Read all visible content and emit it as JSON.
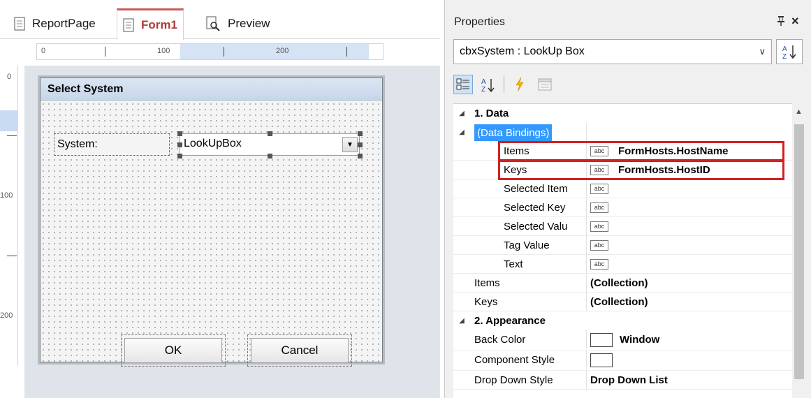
{
  "designer": {
    "tabs": [
      {
        "label": "ReportPage",
        "icon": "page-icon"
      },
      {
        "label": "Form1",
        "icon": "page-icon"
      },
      {
        "label": "Preview",
        "icon": "preview-icon"
      }
    ],
    "ruler_top_labels": [
      "0",
      "100",
      "200"
    ],
    "ruler_left_labels": [
      "0",
      "100",
      "200"
    ],
    "form": {
      "title": "Select System",
      "system_label": "System:",
      "lookup_text": "LookUpBox",
      "ok_label": "OK",
      "cancel_label": "Cancel"
    }
  },
  "properties": {
    "panel_title": "Properties",
    "pin_icon": "pin-icon",
    "close_icon": "close-icon",
    "object_selector": "cbxSystem : LookUp Box",
    "rows": [
      {
        "name": "1. Data",
        "value": "",
        "kind": "category"
      },
      {
        "name": "(Data Bindings)",
        "value": "",
        "kind": "subcategory"
      },
      {
        "name": "Items",
        "value": "FormHosts.HostName",
        "kind": "binding"
      },
      {
        "name": "Keys",
        "value": "FormHosts.HostID",
        "kind": "binding"
      },
      {
        "name": "Selected Item",
        "value": "",
        "kind": "binding"
      },
      {
        "name": "Selected Key",
        "value": "",
        "kind": "binding"
      },
      {
        "name": "Selected Valu",
        "value": "",
        "kind": "binding"
      },
      {
        "name": "Tag Value",
        "value": "",
        "kind": "binding"
      },
      {
        "name": "Text",
        "value": "",
        "kind": "binding"
      },
      {
        "name": "Items",
        "value": "(Collection)",
        "kind": "plain"
      },
      {
        "name": "Keys",
        "value": "(Collection)",
        "kind": "plain"
      },
      {
        "name": "2. Appearance",
        "value": "",
        "kind": "category"
      },
      {
        "name": "Back Color",
        "value": "Window",
        "kind": "color"
      },
      {
        "name": "Component Style",
        "value": "",
        "kind": "color"
      },
      {
        "name": "Drop Down Style",
        "value": "Drop Down List",
        "kind": "plain"
      }
    ],
    "colors": {
      "highlight": "#d32020",
      "selection": "#3399ff"
    }
  }
}
